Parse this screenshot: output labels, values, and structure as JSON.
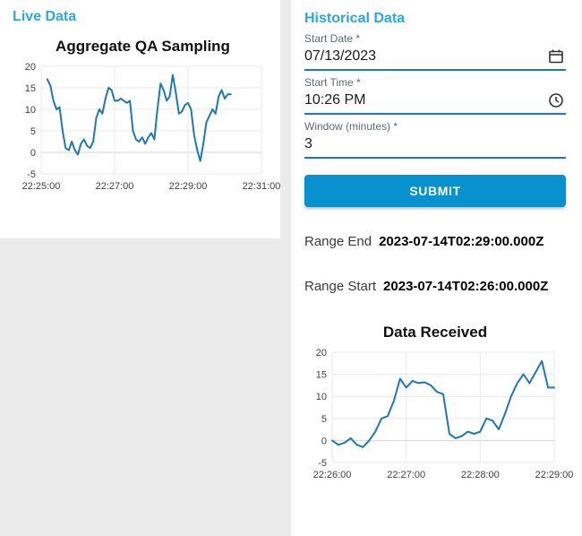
{
  "colors": {
    "heading": "#2ba8e0",
    "underline": "#1976d2",
    "submit_bg": "#0791cf",
    "line": "#1f77b4"
  },
  "live_panel": {
    "heading": "Live Data"
  },
  "historical_panel": {
    "heading": "Historical Data",
    "form": {
      "start_date_label": "Start Date *",
      "start_date_value": "07/13/2023",
      "start_time_label": "Start Time *",
      "start_time_value": "10:26 PM",
      "window_label": "Window (minutes) *",
      "window_value": "3",
      "submit_label": "SUBMIT"
    },
    "range_end_label": "Range End",
    "range_end_value": "2023-07-14T02:29:00.000Z",
    "range_start_label": "Range Start",
    "range_start_value": "2023-07-14T02:26:00.000Z"
  },
  "chart_data": [
    {
      "type": "line",
      "title": "Aggregate QA Sampling",
      "xlabel": "",
      "ylabel": "",
      "xlim": [
        0,
        360
      ],
      "ylim": [
        -5,
        20
      ],
      "grid": true,
      "line_color": "#1f77b4",
      "xtick_values": [
        0,
        120,
        240,
        360
      ],
      "xtick_labels": [
        "22:25:00",
        "22:27:00",
        "22:29:00",
        "22:31:00"
      ],
      "ytick_values": [
        -5,
        0,
        5,
        10,
        15,
        20
      ],
      "x": [
        10,
        15,
        20,
        25,
        30,
        35,
        40,
        45,
        50,
        55,
        60,
        65,
        70,
        75,
        80,
        85,
        90,
        95,
        100,
        105,
        110,
        115,
        120,
        125,
        130,
        135,
        140,
        145,
        150,
        155,
        160,
        165,
        170,
        175,
        180,
        185,
        190,
        195,
        200,
        205,
        210,
        215,
        220,
        225,
        230,
        235,
        240,
        245,
        250,
        255,
        260,
        265,
        270,
        275,
        280,
        285,
        290,
        295,
        300,
        305,
        310
      ],
      "y": [
        17,
        15.5,
        12,
        10,
        10.5,
        5,
        1,
        0.5,
        2.5,
        0.5,
        -0.5,
        2,
        3,
        1.5,
        1,
        2.5,
        8,
        10,
        9,
        12.5,
        15,
        14.5,
        12,
        12,
        12.5,
        12,
        11.5,
        12,
        5,
        3,
        2.5,
        3.5,
        2,
        3.5,
        4.5,
        3,
        10,
        16,
        14.5,
        12,
        13,
        18,
        14,
        9,
        9.5,
        11,
        11.5,
        10,
        4,
        0.5,
        -2,
        2,
        7,
        8.5,
        10,
        9,
        13,
        14.5,
        12.5,
        13.5,
        13.5
      ]
    },
    {
      "type": "line",
      "title": "Data Received",
      "xlabel": "",
      "ylabel": "",
      "xlim": [
        0,
        180
      ],
      "ylim": [
        -5,
        20
      ],
      "grid": true,
      "line_color": "#1f77b4",
      "xtick_values": [
        0,
        60,
        120,
        180
      ],
      "xtick_labels": [
        "22:26:00",
        "22:27:00",
        "22:28:00",
        "22:29:00"
      ],
      "ytick_values": [
        -5,
        0,
        5,
        10,
        15,
        20
      ],
      "x": [
        0,
        5,
        10,
        15,
        20,
        25,
        30,
        35,
        40,
        45,
        50,
        55,
        60,
        65,
        70,
        75,
        80,
        85,
        90,
        95,
        100,
        105,
        110,
        115,
        120,
        125,
        130,
        135,
        140,
        145,
        150,
        155,
        160,
        165,
        170,
        175,
        180
      ],
      "y": [
        0,
        -1,
        -0.5,
        0.5,
        -1,
        -1.5,
        0,
        2,
        5,
        5.5,
        9,
        14,
        12,
        13.5,
        13,
        13.2,
        12.5,
        11,
        10.5,
        1.5,
        0.5,
        1,
        2,
        1.5,
        2,
        5,
        4.5,
        2.5,
        6,
        10,
        13,
        15,
        13,
        15.5,
        18,
        12,
        12
      ]
    }
  ]
}
